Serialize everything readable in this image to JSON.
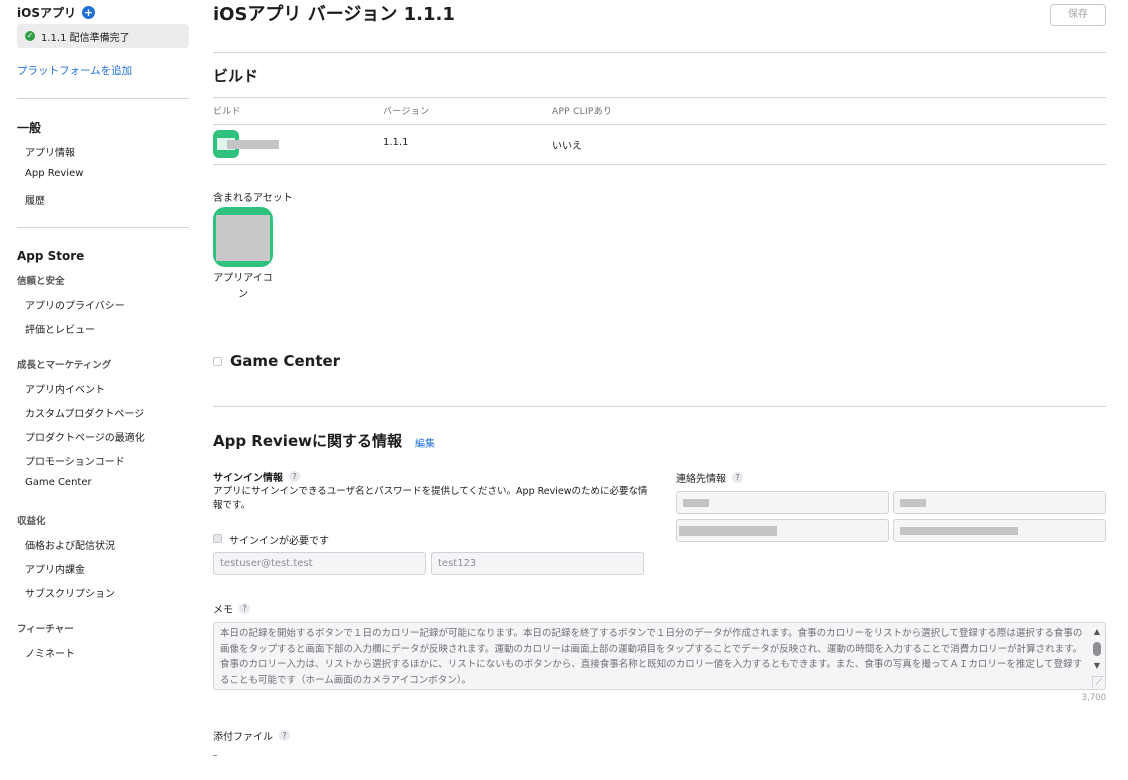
{
  "sidebar": {
    "platform_title": "iOSアプリ",
    "version_label": "1.1.1 配信準備完了",
    "add_platform": "プラットフォームを追加",
    "general_heading": "一般",
    "general_items": [
      "アプリ情報",
      "App Review",
      "履歴"
    ],
    "appstore_heading": "App Store",
    "trust_heading": "信頼と安全",
    "trust_items": [
      "アプリのプライバシー",
      "評価とレビュー"
    ],
    "growth_heading": "成長とマーケティング",
    "growth_items": [
      "アプリ内イベント",
      "カスタムプロダクトページ",
      "プロダクトページの最適化",
      "プロモーションコード",
      "Game Center"
    ],
    "monetize_heading": "収益化",
    "monetize_items": [
      "価格および配信状況",
      "アプリ内課金",
      "サブスクリプション"
    ],
    "featuring_heading": "フィーチャー",
    "featuring_items": [
      "ノミネート"
    ]
  },
  "header": {
    "title": "iOSアプリ バージョン 1.1.1",
    "save_label": "保存"
  },
  "build": {
    "section_title": "ビルド",
    "columns": [
      "ビルド",
      "バージョン",
      "APP CLIPあり"
    ],
    "row": {
      "version": "1.1.1",
      "app_clip": "いいえ"
    }
  },
  "assets": {
    "label": "含まれるアセット",
    "caption": "アプリアイコン"
  },
  "game_center": {
    "title": "Game Center"
  },
  "app_review": {
    "title": "App Reviewに関する情報",
    "edit_label": "編集",
    "signin_label": "サインイン情報",
    "signin_desc": "アプリにサインインできるユーザ名とパスワードを提供してください。App Reviewのために必要な情報です。",
    "signin_required_label": "サインインが必要です",
    "username": "testuser@test.test",
    "password": "test123",
    "contact_label": "連絡先情報",
    "memo_label": "メモ",
    "memo_text": "本日の記録を開始するボタンで１日のカロリー記録が可能になります。本日の記録を終了するボタンで１日分のデータが作成されます。食事のカロリーをリストから選択して登録する際は選択する食事の画像をタップすると画面下部の入力欄にデータが反映されます。運動のカロリーは画面上部の運動項目をタップすることでデータが反映され、運動の時間を入力することで消費カロリーが計算されます。食事のカロリー入力は、リストから選択するほかに、リストにないものボタンから、直接食事名称と既知のカロリー値を入力するともできます。また、食事の写真を撮ってＡＩカロリーを推定して登録することも可能です（ホーム画面のカメラアイコンボタン）。",
    "memo_count": "3,700",
    "attachments_label": "添付ファイル"
  },
  "colors": {
    "accent": "#1f6fd6",
    "status_green": "#2f9e44",
    "app_icon_green": "#2ec27e"
  }
}
